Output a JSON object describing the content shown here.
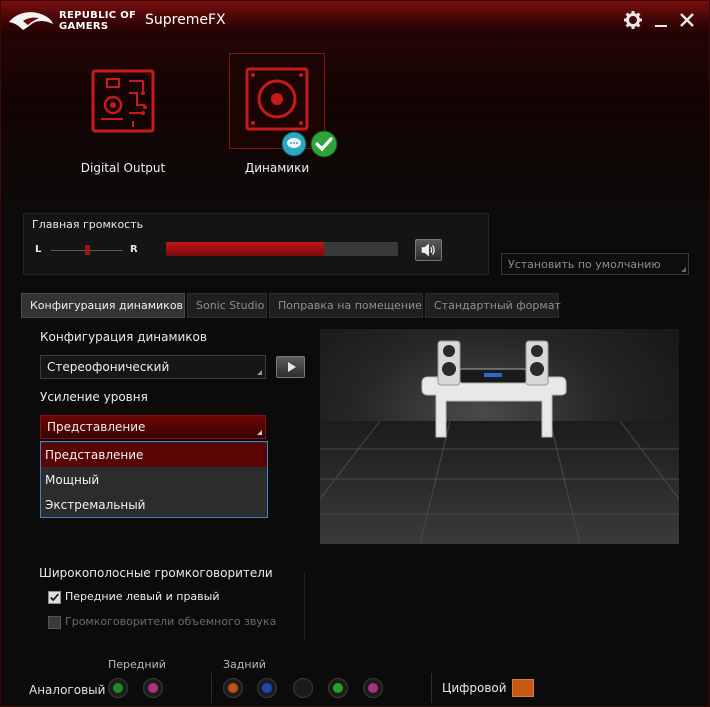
{
  "window": {
    "brand_line1": "REPUBLIC OF",
    "brand_line2": "GAMERS",
    "title": "SupremeFX"
  },
  "devices": [
    {
      "label": "Digital Output",
      "selected": false
    },
    {
      "label": "Динамики",
      "selected": true
    }
  ],
  "volume": {
    "title": "Главная громкость",
    "left_label": "L",
    "right_label": "R",
    "level": 0.68,
    "balance": 0.5
  },
  "default_button": {
    "label": "Установить по умолчанию"
  },
  "tabs": [
    {
      "label": "Конфигурация динамиков",
      "active": true
    },
    {
      "label": "Sonic Studio",
      "active": false
    },
    {
      "label": "Поправка на помещение",
      "active": false
    },
    {
      "label": "Стандартный формат",
      "active": false
    }
  ],
  "config": {
    "speaker_config_label": "Конфигурация динамиков",
    "speaker_config_value": "Стереофонический",
    "gain_label": "Усиление уровня",
    "gain_value": "Представление",
    "gain_options": [
      "Представление",
      "Мощный",
      "Экстремальный"
    ],
    "gain_selected_index": 0
  },
  "wideband": {
    "title": "Широкополосные громкоговорители",
    "front": {
      "label": "Передние левый и правый",
      "checked": true
    },
    "surround": {
      "label": "Громкоговорители объемного звука",
      "checked": false
    }
  },
  "jacks": {
    "analog_label": "Аналоговый",
    "front_label": "Передний",
    "rear_label": "Задний",
    "digital_label": "Цифровой",
    "front_colors": [
      "#1f8a2a",
      "#b0307a"
    ],
    "rear_colors": [
      "#c0501a",
      "#2048b0",
      "#1a1a1a",
      "#25a030",
      "#b0307a"
    ]
  },
  "colors": {
    "accent": "#c11818",
    "check_green": "#2ea33a",
    "chat_teal": "#2aa8c0"
  }
}
